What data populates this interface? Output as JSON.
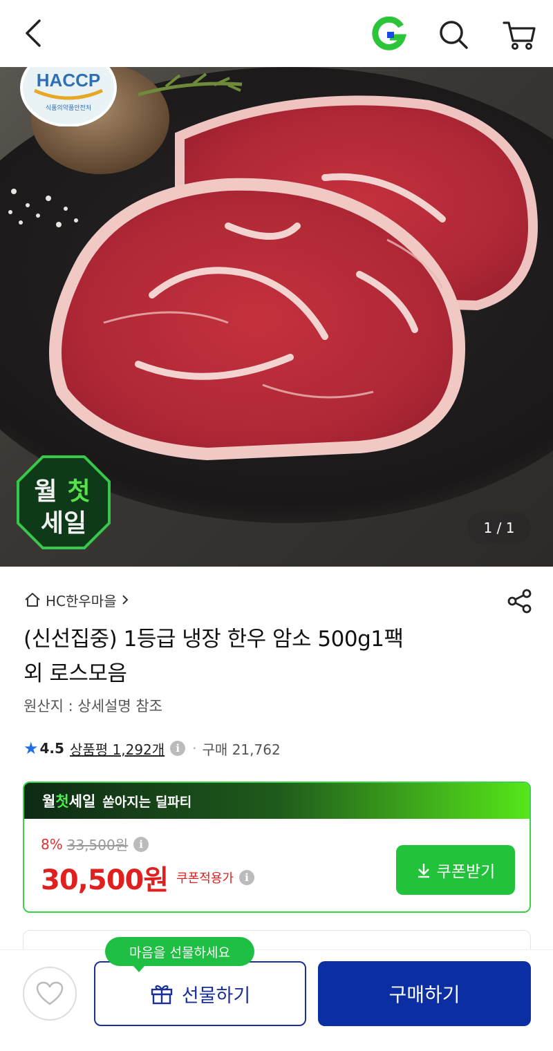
{
  "header": {
    "back_icon": "chevron-left-icon",
    "g_logo_icon": "gmarket-g-icon",
    "search_icon": "search-icon",
    "cart_icon": "cart-icon"
  },
  "hero": {
    "page_counter": "1 / 1",
    "haccp_label": "HACCP",
    "haccp_sub": "식품의약품안전처",
    "sale_badge_line1_a": "월",
    "sale_badge_line1_b": "첫",
    "sale_badge_line2": "세일"
  },
  "product": {
    "shop_name": "HC한우마을",
    "title_line1": "(신선집중) 1등급 냉장 한우 암소 500g1팩",
    "title_line2": "외 로스모음",
    "origin": "원산지 : 상세설명 참조",
    "rating": "4.5",
    "reviews": "상품평 1,292개",
    "purchases": "구매 21,762"
  },
  "deal": {
    "brand_a": "월",
    "brand_b": "첫",
    "brand_c": "세일",
    "headline": "쏟아지는 딜파티",
    "discount_pct": "8%",
    "original_price": "33,500원",
    "price": "30,500원",
    "coupon_label": "쿠폰적용가",
    "coupon_button": "쿠폰받기"
  },
  "bottom": {
    "gift_tooltip": "마음을 선물하세요",
    "gift_button": "선물하기",
    "buy_button": "구매하기"
  },
  "colors": {
    "brand_green": "#22c23a",
    "buy_blue": "#0b2fa3",
    "price_red": "#e01f1f"
  }
}
